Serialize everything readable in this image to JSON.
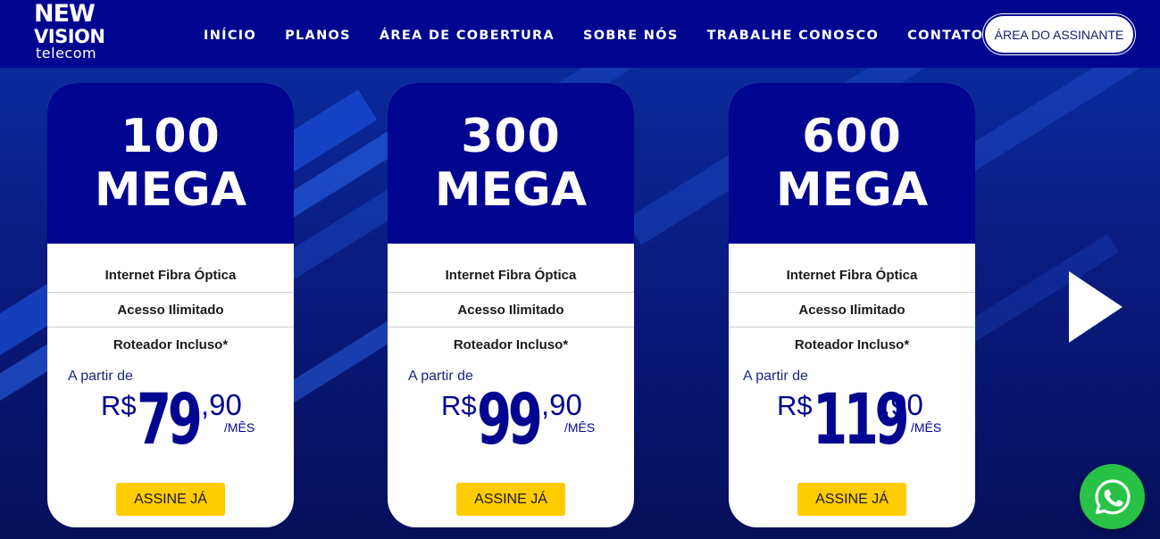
{
  "header": {
    "logo": {
      "line1": "NEW",
      "line2": "VISION",
      "line3": "telecom"
    },
    "nav": [
      {
        "label": "INÍCIO"
      },
      {
        "label": "PLANOS"
      },
      {
        "label": "ÁREA DE COBERTURA"
      },
      {
        "label": "SOBRE NÓS"
      },
      {
        "label": "TRABALHE CONOSCO"
      },
      {
        "label": "CONTATO"
      }
    ],
    "subscriber_button": "ÁREA DO ASSINANTE"
  },
  "plans": [
    {
      "speed": "100",
      "unit": "MEGA",
      "features": [
        "Internet Fibra Óptica",
        "Acesso Ilimitado",
        "Roteador Incluso*"
      ],
      "from_label": "A partir de",
      "currency": "R$",
      "price_int": "79",
      "price_cents": ",90",
      "period": "/MÊS",
      "cta": "ASSINE JÁ"
    },
    {
      "speed": "300",
      "unit": "MEGA",
      "features": [
        "Internet Fibra Óptica",
        "Acesso Ilimitado",
        "Roteador Incluso*"
      ],
      "from_label": "A partir de",
      "currency": "R$",
      "price_int": "99",
      "price_cents": ",90",
      "period": "/MÊS",
      "cta": "ASSINE JÁ"
    },
    {
      "speed": "600",
      "unit": "MEGA",
      "features": [
        "Internet Fibra Óptica",
        "Acesso Ilimitado",
        "Roteador Incluso*"
      ],
      "from_label": "A partir de",
      "currency": "R$",
      "price_int": "119",
      "price_cents": ",90",
      "period": "/MÊS",
      "cta": "ASSINE JÁ"
    }
  ],
  "icons": {
    "next": "chevron-right-icon",
    "whatsapp": "whatsapp-icon"
  },
  "colors": {
    "header": "#00068f",
    "cta": "#ffcc00",
    "whatsapp": "#28c346"
  }
}
